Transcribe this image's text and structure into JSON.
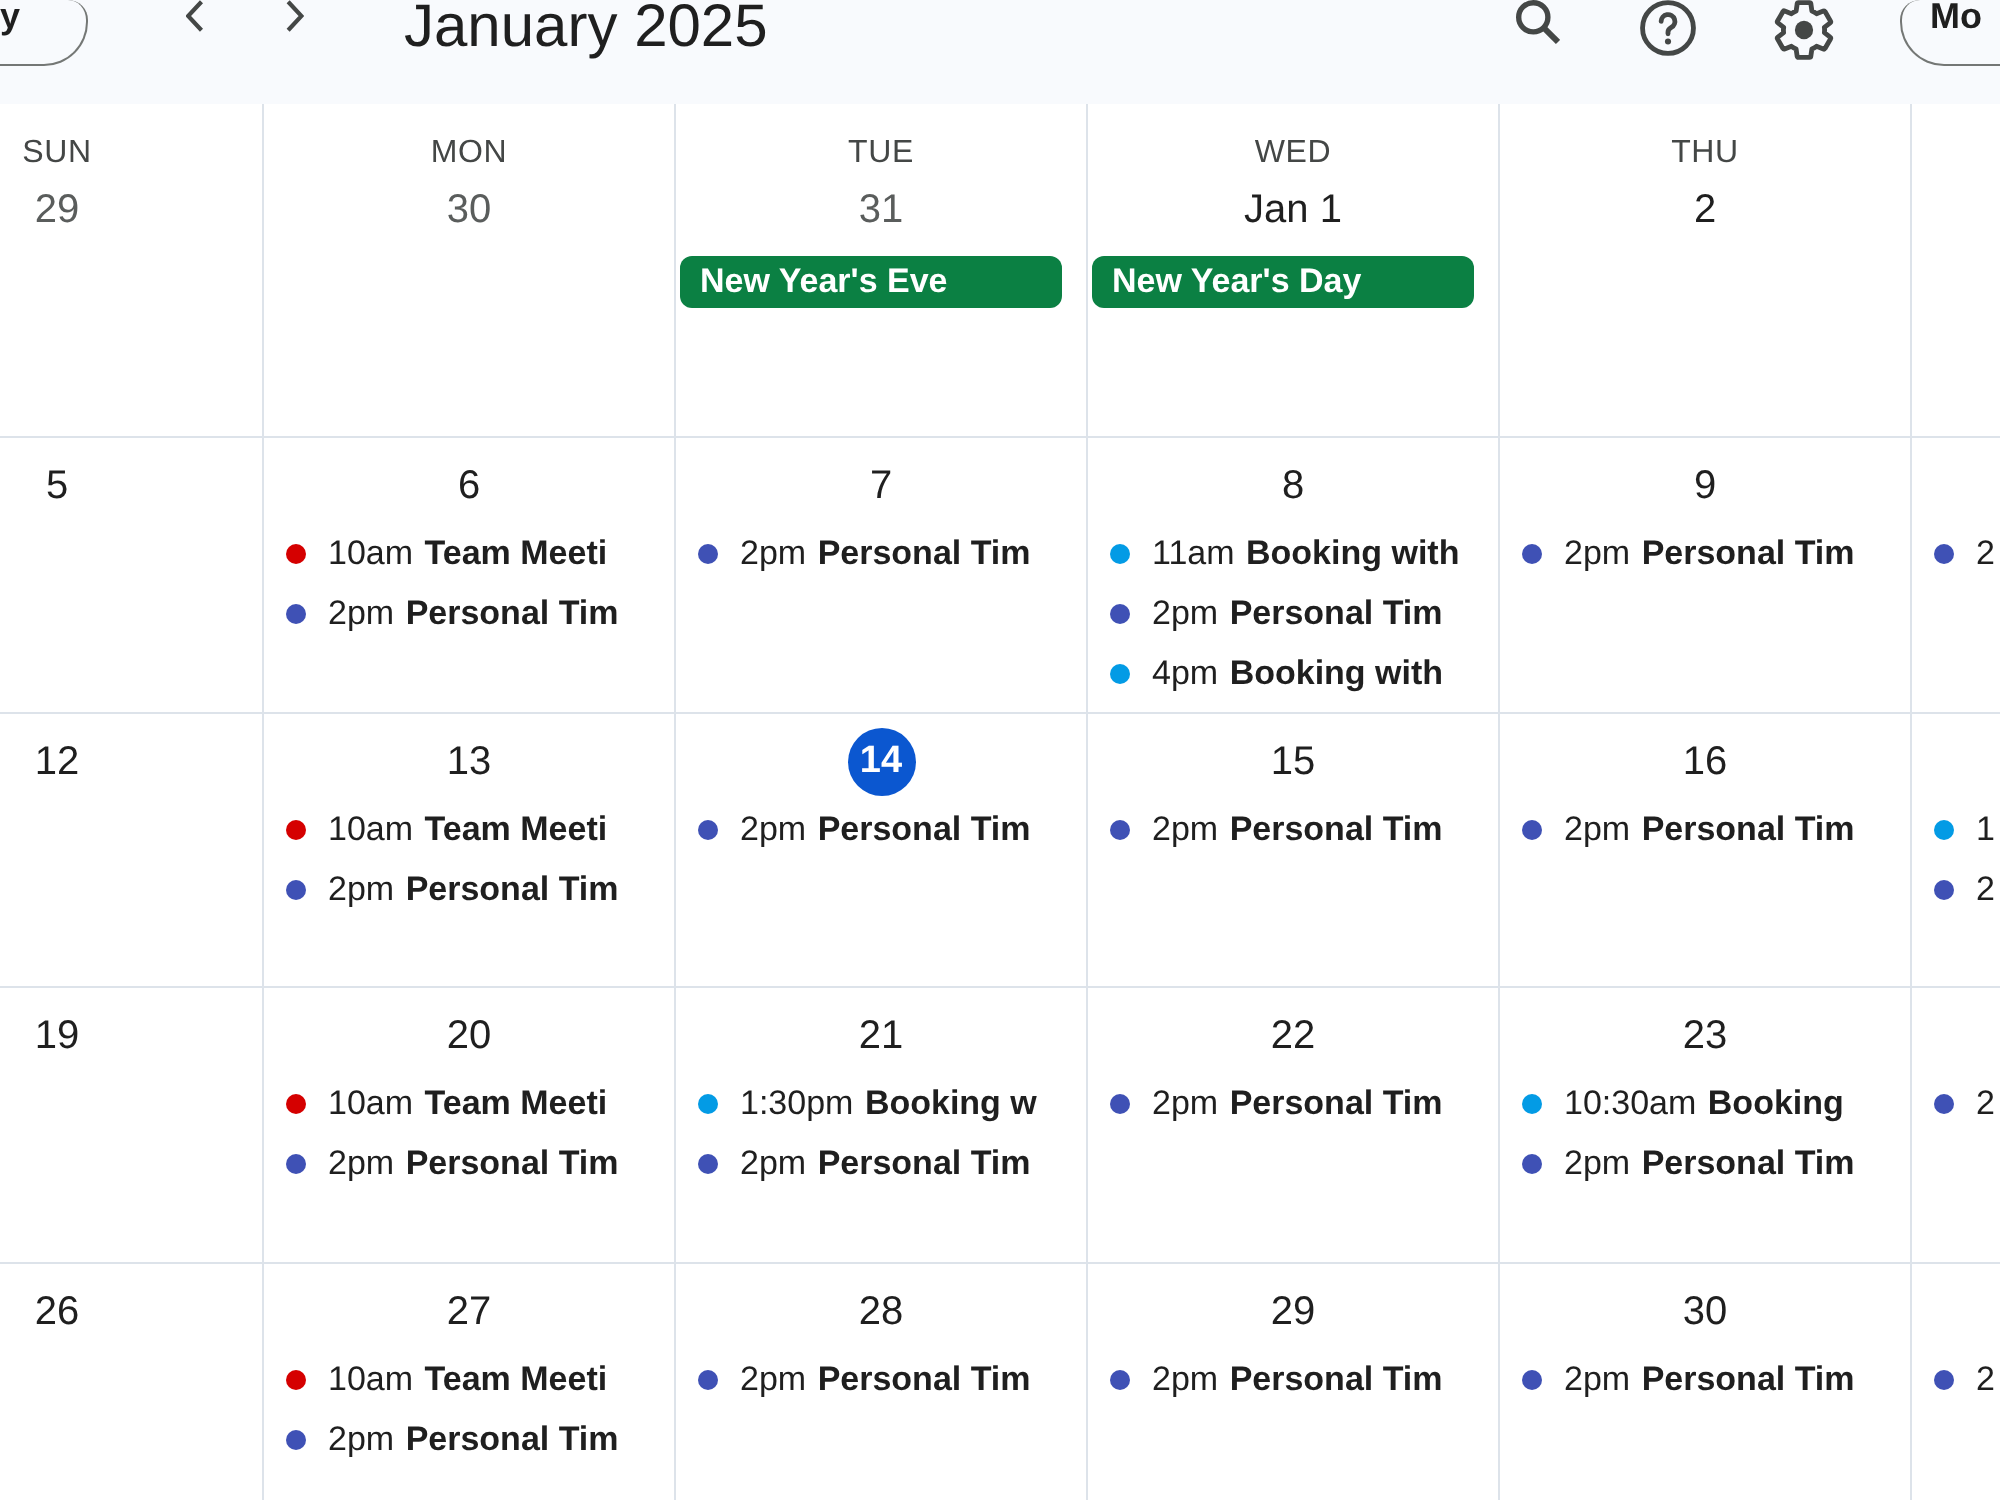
{
  "toolbar": {
    "today_button": "y",
    "title": "January 2025",
    "view_button": "Mo"
  },
  "weekdays": [
    "SUN",
    "MON",
    "TUE",
    "WED",
    "THU"
  ],
  "weeks": [
    {
      "days": [
        {
          "date": "29",
          "other_month": true,
          "today": false
        },
        {
          "date": "30",
          "other_month": true,
          "today": false
        },
        {
          "date": "31",
          "other_month": true,
          "today": false,
          "holidays": [
            {
              "title": "New Year's Eve"
            }
          ]
        },
        {
          "date": "Jan 1",
          "other_month": false,
          "today": false,
          "holidays": [
            {
              "title": "New Year's Day"
            }
          ]
        },
        {
          "date": "2",
          "other_month": false,
          "today": false
        }
      ]
    },
    {
      "days": [
        {
          "date": "5",
          "other_month": false,
          "today": false
        },
        {
          "date": "6",
          "other_month": false,
          "today": false,
          "events": [
            {
              "time": "10am",
              "title": "Team Meeti",
              "color": "#d50000"
            },
            {
              "time": "2pm",
              "title": "Personal Tim",
              "color": "#3f51b5"
            }
          ]
        },
        {
          "date": "7",
          "other_month": false,
          "today": false,
          "events": [
            {
              "time": "2pm",
              "title": "Personal Tim",
              "color": "#3f51b5"
            }
          ]
        },
        {
          "date": "8",
          "other_month": false,
          "today": false,
          "events": [
            {
              "time": "11am",
              "title": "Booking with",
              "color": "#039be5"
            },
            {
              "time": "2pm",
              "title": "Personal Tim",
              "color": "#3f51b5"
            },
            {
              "time": "4pm",
              "title": "Booking with",
              "color": "#039be5"
            }
          ]
        },
        {
          "date": "9",
          "other_month": false,
          "today": false,
          "events": [
            {
              "time": "2pm",
              "title": "Personal Tim",
              "color": "#3f51b5"
            }
          ]
        },
        {
          "events": [
            {
              "time": "2",
              "color": "#3f51b5"
            }
          ]
        }
      ]
    },
    {
      "days": [
        {
          "date": "12",
          "other_month": false,
          "today": false
        },
        {
          "date": "13",
          "other_month": false,
          "today": false,
          "events": [
            {
              "time": "10am",
              "title": "Team Meeti",
              "color": "#d50000"
            },
            {
              "time": "2pm",
              "title": "Personal Tim",
              "color": "#3f51b5"
            }
          ]
        },
        {
          "date": "14",
          "other_month": false,
          "today": true,
          "events": [
            {
              "time": "2pm",
              "title": "Personal Tim",
              "color": "#3f51b5"
            }
          ]
        },
        {
          "date": "15",
          "other_month": false,
          "today": false,
          "events": [
            {
              "time": "2pm",
              "title": "Personal Tim",
              "color": "#3f51b5"
            }
          ]
        },
        {
          "date": "16",
          "other_month": false,
          "today": false,
          "events": [
            {
              "time": "2pm",
              "title": "Personal Tim",
              "color": "#3f51b5"
            }
          ]
        },
        {
          "events": [
            {
              "time": "1",
              "color": "#039be5"
            },
            {
              "time": "2",
              "color": "#3f51b5"
            }
          ]
        }
      ]
    },
    {
      "days": [
        {
          "date": "19",
          "other_month": false,
          "today": false
        },
        {
          "date": "20",
          "other_month": false,
          "today": false,
          "events": [
            {
              "time": "10am",
              "title": "Team Meeti",
              "color": "#d50000"
            },
            {
              "time": "2pm",
              "title": "Personal Tim",
              "color": "#3f51b5"
            }
          ]
        },
        {
          "date": "21",
          "other_month": false,
          "today": false,
          "events": [
            {
              "time": "1:30pm",
              "title": "Booking w",
              "color": "#039be5"
            },
            {
              "time": "2pm",
              "title": "Personal Tim",
              "color": "#3f51b5"
            }
          ]
        },
        {
          "date": "22",
          "other_month": false,
          "today": false,
          "events": [
            {
              "time": "2pm",
              "title": "Personal Tim",
              "color": "#3f51b5"
            }
          ]
        },
        {
          "date": "23",
          "other_month": false,
          "today": false,
          "events": [
            {
              "time": "10:30am",
              "title": "Booking",
              "color": "#039be5"
            },
            {
              "time": "2pm",
              "title": "Personal Tim",
              "color": "#3f51b5"
            }
          ]
        },
        {
          "events": [
            {
              "time": "2",
              "color": "#3f51b5"
            }
          ]
        }
      ]
    },
    {
      "days": [
        {
          "date": "26",
          "other_month": false,
          "today": false
        },
        {
          "date": "27",
          "other_month": false,
          "today": false,
          "events": [
            {
              "time": "10am",
              "title": "Team Meeti",
              "color": "#d50000"
            },
            {
              "time": "2pm",
              "title": "Personal Tim",
              "color": "#3f51b5"
            }
          ]
        },
        {
          "date": "28",
          "other_month": false,
          "today": false,
          "events": [
            {
              "time": "2pm",
              "title": "Personal Tim",
              "color": "#3f51b5"
            }
          ]
        },
        {
          "date": "29",
          "other_month": false,
          "today": false,
          "events": [
            {
              "time": "2pm",
              "title": "Personal Tim",
              "color": "#3f51b5"
            }
          ]
        },
        {
          "date": "30",
          "other_month": false,
          "today": false,
          "events": [
            {
              "time": "2pm",
              "title": "Personal Tim",
              "color": "#3f51b5"
            }
          ]
        },
        {
          "events": [
            {
              "time": "2",
              "color": "#3f51b5"
            }
          ]
        }
      ]
    }
  ]
}
